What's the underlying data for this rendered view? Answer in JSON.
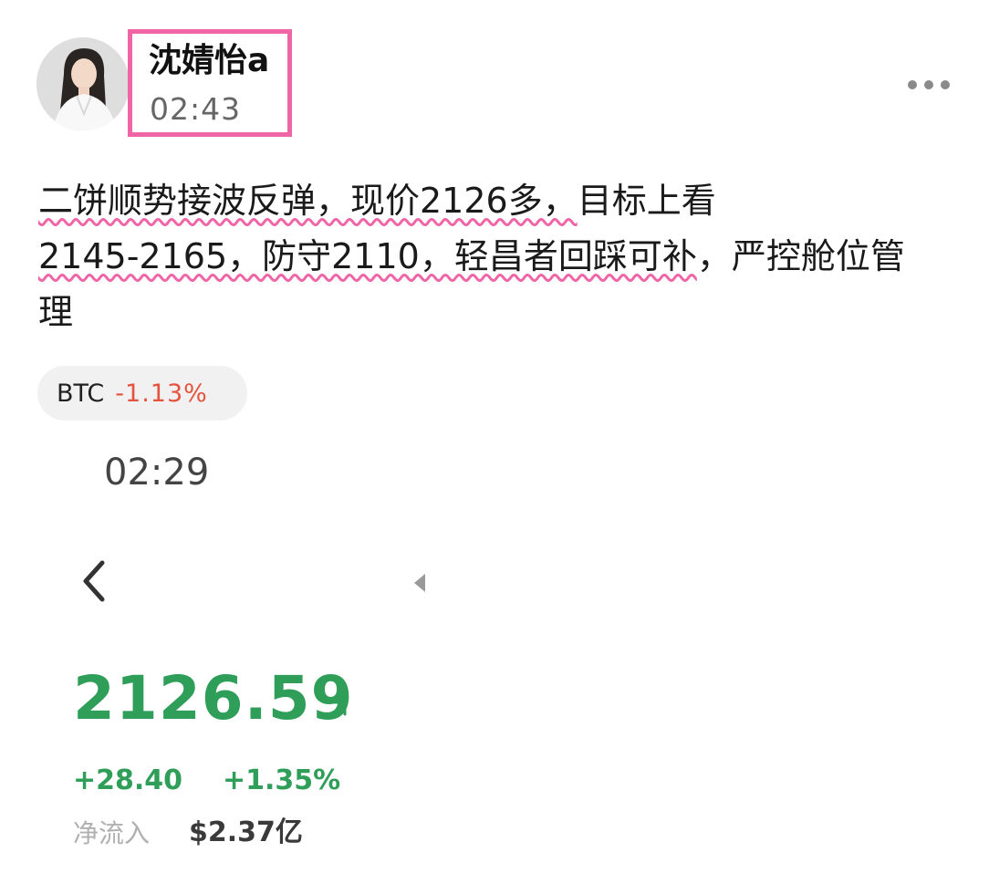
{
  "post": {
    "author_name": "沈婧怡a",
    "time": "02:43",
    "more_icon": "more-dots-icon",
    "text_lines": [
      {
        "underlined": "二饼顺势接波反弹，现价2126多，",
        "plain": "目标上看"
      },
      {
        "underlined": "2145-2165，防守2110，轻昌者回踩可补",
        "plain": "，严控舱位管"
      },
      {
        "underlined": "",
        "plain": "理"
      }
    ],
    "accent_color": "#f065a6"
  },
  "tag": {
    "symbol": "BTC",
    "change": "-1.13%",
    "change_color": "#e5533d"
  },
  "screenshot": {
    "time": "02:29",
    "back_icon": "chevron-left-icon",
    "price": "2126.59",
    "trend_icon": "arrow-up-right-icon",
    "change_abs": "+28.40",
    "change_pct": "+1.35%",
    "netflow_label": "净流入",
    "netflow_value": "$2.37亿",
    "up_color": "#2f9e59"
  }
}
